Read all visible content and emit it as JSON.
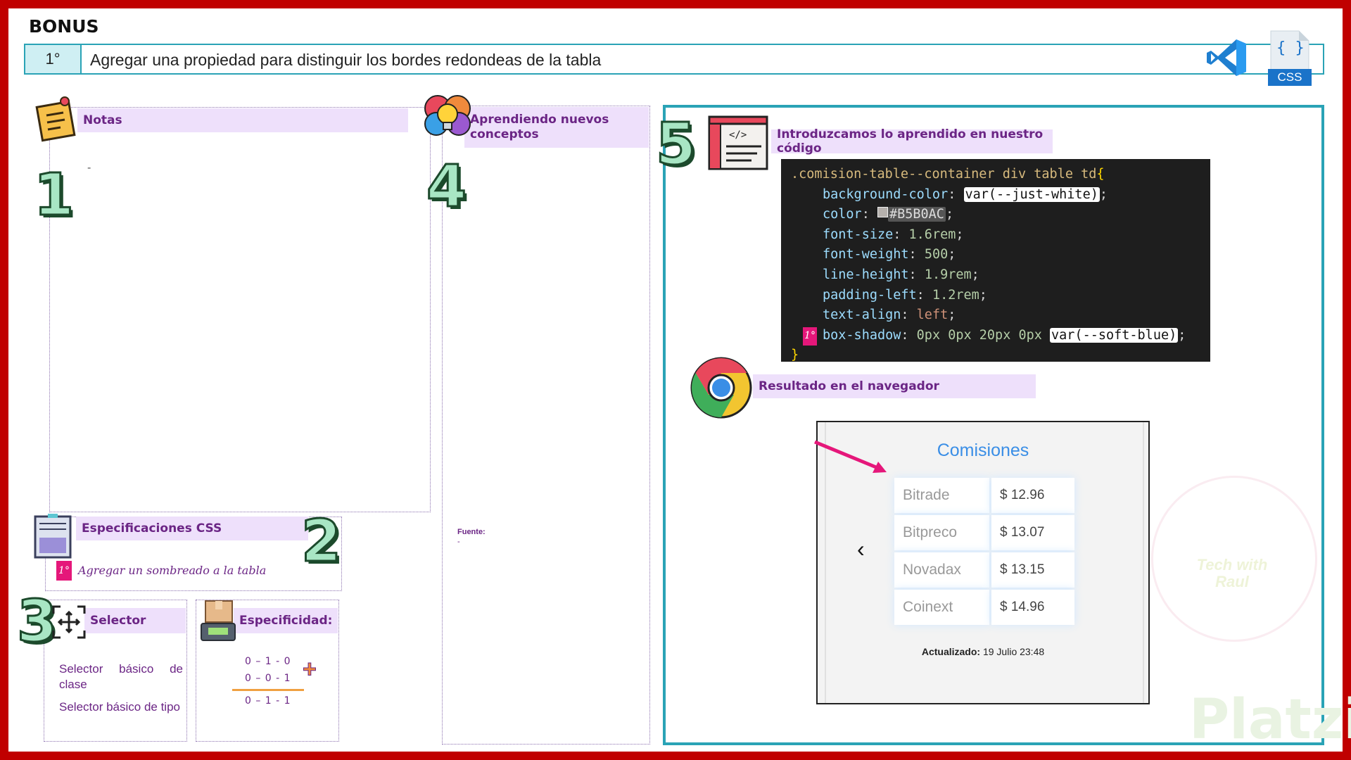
{
  "header": {
    "bonus": "BONUS",
    "number": "1°",
    "task": "Agregar una propiedad para distinguir los bordes redondeas de la tabla",
    "css_icon_label": "CSS",
    "css_icon_braces": "{ }",
    "icons": [
      "vscode-icon",
      "css-file-icon"
    ]
  },
  "notas": {
    "title": "Notas",
    "number": "1",
    "body": "-"
  },
  "aprendiendo": {
    "title_line1": "Aprendiendo nuevos",
    "title_line2": "conceptos",
    "number": "4",
    "fuente_label": "Fuente:",
    "fuente_value": "-"
  },
  "especificaciones": {
    "title": "Especificaciones CSS",
    "number": "2",
    "badge": "1°",
    "item": "Agregar un sombreado a la tabla"
  },
  "selector": {
    "number": "3",
    "title": "Selector",
    "item1": "Selector básico de clase",
    "item2": "Selector básico de tipo"
  },
  "especificidad": {
    "title": "Especificidad:",
    "row1": "0 – 1 - 0",
    "row2": "0 – 0 - 1",
    "total": "0 – 1 - 1",
    "plus": "+"
  },
  "codigo": {
    "number": "5",
    "title": "Introduzcamos lo aprendido en nuestro código",
    "selector": ".comision-table--container div table td",
    "open_brace": "{",
    "close_brace": "}",
    "badge": "1°",
    "lines": [
      {
        "prop": "background-color",
        "value": "var(--just-white)"
      },
      {
        "prop": "color",
        "value": "#B5B0AC"
      },
      {
        "prop": "font-size",
        "value": "1.6rem"
      },
      {
        "prop": "font-weight",
        "value": "500"
      },
      {
        "prop": "line-height",
        "value": "1.9rem"
      },
      {
        "prop": "padding-left",
        "value": "1.2rem"
      },
      {
        "prop": "text-align",
        "value": "left"
      },
      {
        "prop": "box-shadow",
        "value_prefix": "0px 0px 20px 0px",
        "value": "var(--soft-blue)"
      }
    ]
  },
  "resultado": {
    "title": "Resultado en el navegador",
    "heading": "Comisiones",
    "back": "‹",
    "rows": [
      {
        "name": "Bitrade",
        "value": "$ 12.96"
      },
      {
        "name": "Bitpreco",
        "value": "$ 13.07"
      },
      {
        "name": "Novadax",
        "value": "$ 13.15"
      },
      {
        "name": "Coinext",
        "value": "$ 14.96"
      }
    ],
    "updated_label": "Actualizado:",
    "updated_value": "19 Julio 23:48",
    "swatch_color": "#B5B0AC"
  },
  "watermark": {
    "brand": "Platzi",
    "badge_line1": "Tech with",
    "badge_line2": "Raul"
  },
  "colors": {
    "frame": "#c00000",
    "accent_teal": "#2aa3b6",
    "label_bg": "#eee0fb",
    "label_text": "#6b2585",
    "pink": "#e5177a",
    "number_fill": "#a8e6c4"
  }
}
